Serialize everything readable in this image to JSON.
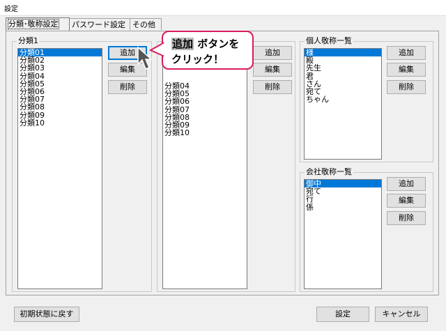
{
  "window": {
    "title": "設定"
  },
  "tabs": [
    {
      "label": "分類･敬称設定"
    },
    {
      "label": "パスワード設定"
    },
    {
      "label": "その他"
    }
  ],
  "group1": {
    "label": "分類1",
    "items": [
      "分類01",
      "分類02",
      "分類03",
      "分類04",
      "分類05",
      "分類06",
      "分類07",
      "分類08",
      "分類09",
      "分類10"
    ],
    "selected_index": 0,
    "buttons": {
      "add": "追加",
      "edit": "編集",
      "delete": "削除"
    }
  },
  "group2": {
    "label": "",
    "items": [
      "分類04",
      "分類05",
      "分類06",
      "分類07",
      "分類08",
      "分類09",
      "分類10"
    ],
    "buttons": {
      "add": "追加",
      "edit": "編集",
      "delete": "削除"
    }
  },
  "personal": {
    "label": "個人敬称一覧",
    "items": [
      "様",
      "殿",
      "先生",
      "君",
      "さん",
      "宛て",
      "ちゃん"
    ],
    "selected_index": 0,
    "buttons": {
      "add": "追加",
      "edit": "編集",
      "delete": "削除"
    }
  },
  "company": {
    "label": "会社敬称一覧",
    "items": [
      "御中",
      "宛て",
      "行",
      "係"
    ],
    "selected_index": 0,
    "buttons": {
      "add": "追加",
      "edit": "編集",
      "delete": "削除"
    }
  },
  "footer": {
    "reset": "初期状態に戻す",
    "ok": "設定",
    "cancel": "キャンセル"
  },
  "callout": {
    "highlight": "追加",
    "line1_rest": " ボタンを",
    "line2": "クリック！"
  },
  "colors": {
    "selection": "#0078d7",
    "callout_border": "#d81b60"
  }
}
